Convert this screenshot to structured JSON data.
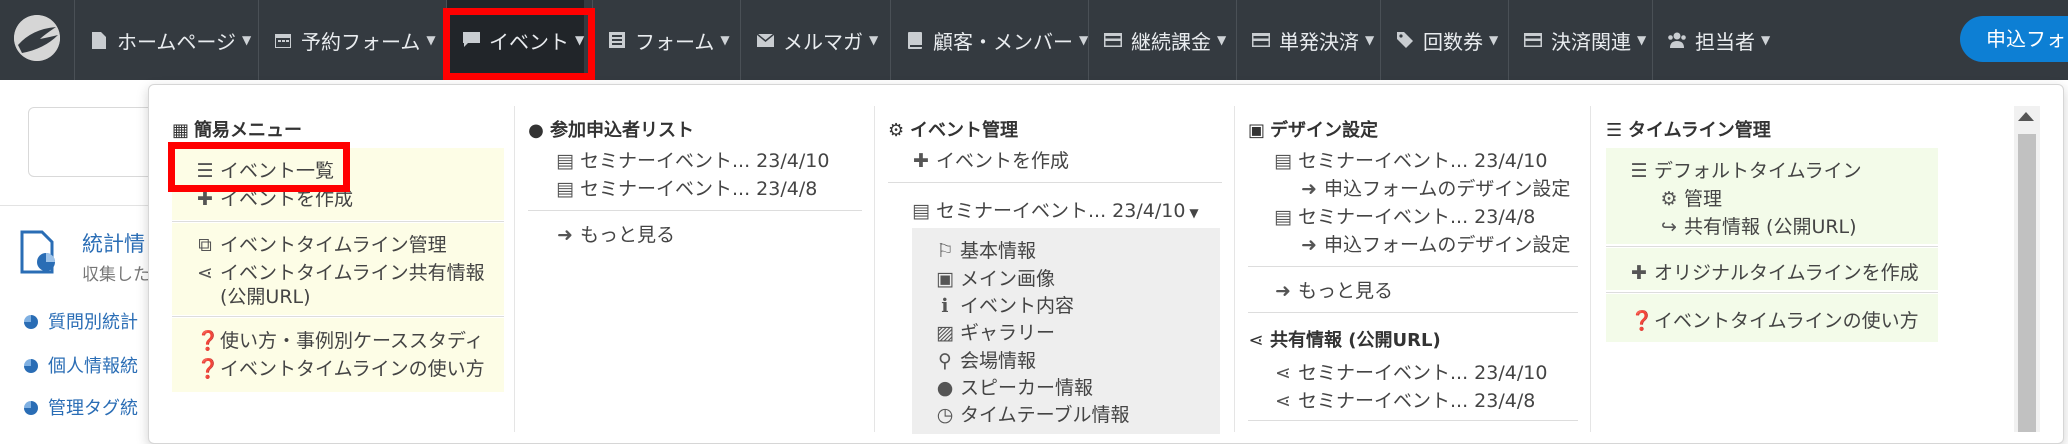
{
  "nav": {
    "items": [
      {
        "label": "ホームページ",
        "icon": "file-icon"
      },
      {
        "label": "予約フォーム",
        "icon": "calendar-icon"
      },
      {
        "label": "イベント",
        "icon": "comment-icon"
      },
      {
        "label": "フォーム",
        "icon": "list-alt-icon"
      },
      {
        "label": "メルマガ",
        "icon": "envelope-icon"
      },
      {
        "label": "顧客・メンバー",
        "icon": "book-icon"
      },
      {
        "label": "継続課金",
        "icon": "credit-card-icon"
      },
      {
        "label": "単発決済",
        "icon": "credit-card-icon"
      },
      {
        "label": "回数券",
        "icon": "tag-icon"
      },
      {
        "label": "決済関連",
        "icon": "credit-card-icon"
      },
      {
        "label": "担当者",
        "icon": "users-icon"
      }
    ],
    "cta_label": "申込フォー",
    "highlight_color": "#ff0000",
    "cta_color": "#0d7fd4"
  },
  "background": {
    "title": "統計情",
    "subtitle": "収集した",
    "links": [
      "質問別統計",
      "個人情報統",
      "管理タグ統"
    ]
  },
  "menu": {
    "simple": {
      "header": "簡易メニュー",
      "items": [
        "イベント一覧",
        "イベントを作成",
        "イベントタイムライン管理",
        "イベントタイムライン共有情報",
        "(公開URL)",
        "使い方・事例別ケーススタディ",
        "イベントタイムラインの使い方"
      ]
    },
    "participants": {
      "header": "参加申込者リスト",
      "items": [
        "セミナーイベント... 23/4/10",
        "セミナーイベント... 23/4/8"
      ],
      "more": "もっと見る"
    },
    "event_admin": {
      "header": "イベント管理",
      "create": "イベントを作成",
      "selected": "セミナーイベント... 23/4/10",
      "submenu": [
        "基本情報",
        "メイン画像",
        "イベント内容",
        "ギャラリー",
        "会場情報",
        "スピーカー情報",
        "タイムテーブル情報"
      ]
    },
    "design": {
      "header": "デザイン設定",
      "items": [
        "セミナーイベント... 23/4/10",
        "申込フォームのデザイン設定",
        "セミナーイベント... 23/4/8",
        "申込フォームのデザイン設定"
      ],
      "more": "もっと見る"
    },
    "share": {
      "header": "共有情報 (公開URL)",
      "items": [
        "セミナーイベント... 23/4/10",
        "セミナーイベント... 23/4/8"
      ]
    },
    "timeline": {
      "header": "タイムライン管理",
      "items": [
        "デフォルトタイムライン",
        "管理",
        "共有情報 (公開URL)",
        "オリジナルタイムラインを作成",
        "イベントタイムラインの使い方"
      ]
    }
  }
}
